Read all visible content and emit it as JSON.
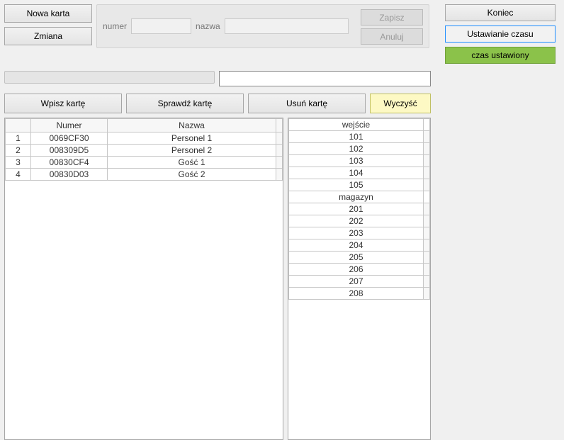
{
  "buttons": {
    "nowa_karta": "Nowa karta",
    "zmiana": "Zmiana",
    "zapisz": "Zapisz",
    "anuluj": "Anuluj",
    "koniec": "Koniec",
    "ustawianie_czasu": "Ustawianie czasu",
    "czas_ustawiony": "czas ustawiony",
    "wpisz_karte": "Wpisz kartę",
    "sprawdz_karte": "Sprawdź kartę",
    "usun_karte": "Usuń kartę",
    "wyczysc": "Wyczyść"
  },
  "form": {
    "numer_label": "numer",
    "numer_value": "",
    "nazwa_label": "nazwa",
    "nazwa_value": ""
  },
  "search": {
    "value": ""
  },
  "left_table": {
    "headers": {
      "numer": "Numer",
      "nazwa": "Nazwa"
    },
    "rows": [
      {
        "idx": "1",
        "numer": "0069CF30",
        "nazwa": "Personel 1"
      },
      {
        "idx": "2",
        "numer": "008309D5",
        "nazwa": "Personel 2"
      },
      {
        "idx": "3",
        "numer": "00830CF4",
        "nazwa": "Gość 1"
      },
      {
        "idx": "4",
        "numer": "00830D03",
        "nazwa": "Gość 2"
      }
    ]
  },
  "right_table": {
    "groups": [
      {
        "name": "wejście",
        "items": [
          "101",
          "102",
          "103",
          "104",
          "105"
        ]
      },
      {
        "name": "magazyn",
        "items": [
          "201",
          "202",
          "203",
          "204",
          "205",
          "206",
          "207",
          "208"
        ]
      }
    ]
  }
}
